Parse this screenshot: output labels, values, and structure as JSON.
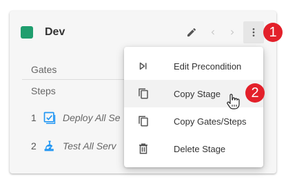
{
  "stage": {
    "name": "Dev",
    "color": "#1f9e6e"
  },
  "toolbar": {
    "edit_icon": "pencil-icon",
    "prev_icon": "chevron-left-icon",
    "next_icon": "chevron-right-icon",
    "more_icon": "more-vert-icon"
  },
  "sections": {
    "gates_label": "Gates",
    "steps_label": "Steps"
  },
  "steps": [
    {
      "number": "1",
      "name": "Deploy All Se",
      "icon": "deploy-check-icon"
    },
    {
      "number": "2",
      "name": "Test All Serv",
      "icon": "microscope-icon"
    }
  ],
  "menu": {
    "items": [
      {
        "label": "Edit Precondition",
        "icon": "skip-next-icon"
      },
      {
        "label": "Copy Stage",
        "icon": "copy-icon",
        "hovered": true
      },
      {
        "label": "Copy Gates/Steps",
        "icon": "copy-icon"
      },
      {
        "label": "Delete Stage",
        "icon": "trash-icon"
      }
    ]
  },
  "annotations": {
    "badge1": "1",
    "badge2": "2",
    "badge_color": "#e3202a"
  },
  "colors": {
    "accent_blue": "#2196f3"
  }
}
